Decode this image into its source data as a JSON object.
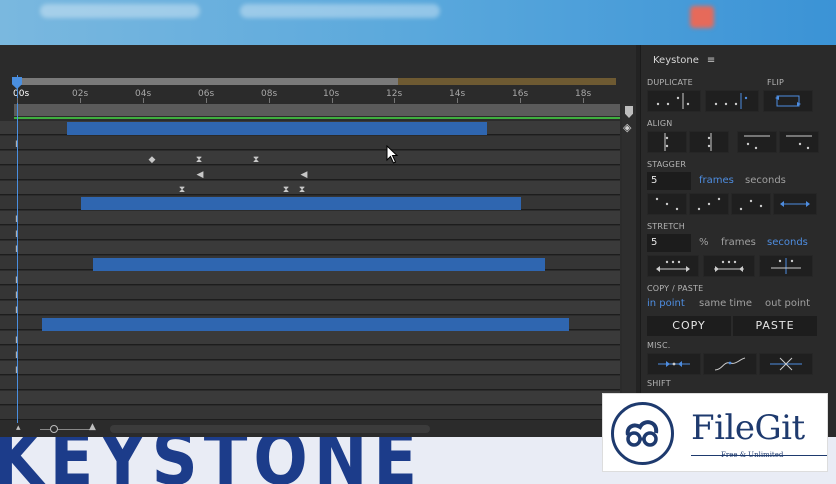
{
  "timeline": {
    "current_time": "00s",
    "ticks": [
      "02s",
      "04s",
      "06s",
      "08s",
      "10s",
      "12s",
      "14s",
      "16s",
      "18s"
    ]
  },
  "panel": {
    "title": "Keystone",
    "menu_icon": "hamburger-icon",
    "labels": {
      "duplicate": "DUPLICATE",
      "flip": "FLIP",
      "align": "ALIGN",
      "stagger": "STAGGER",
      "stretch": "STRETCH",
      "copy_paste": "COPY / PASTE",
      "misc": "MISC.",
      "shift": "SHIFT"
    },
    "stagger": {
      "value": "5",
      "unit_frames": "frames",
      "unit_seconds": "seconds"
    },
    "stretch": {
      "value": "5",
      "unit_percent": "%",
      "unit_frames": "frames",
      "unit_seconds": "seconds"
    },
    "copy_paste": {
      "in_point": "in point",
      "same_time": "same time",
      "out_point": "out point",
      "copy": "COPY",
      "paste": "PASTE"
    }
  },
  "watermark": {
    "brand": "FileGit",
    "tagline": "Free & Unlimited",
    "background_text": "KEYSTONE"
  },
  "colors": {
    "accent": "#4e8de0",
    "layer_bar": "#2f66b0",
    "work_area_end": "#6e5a32"
  }
}
